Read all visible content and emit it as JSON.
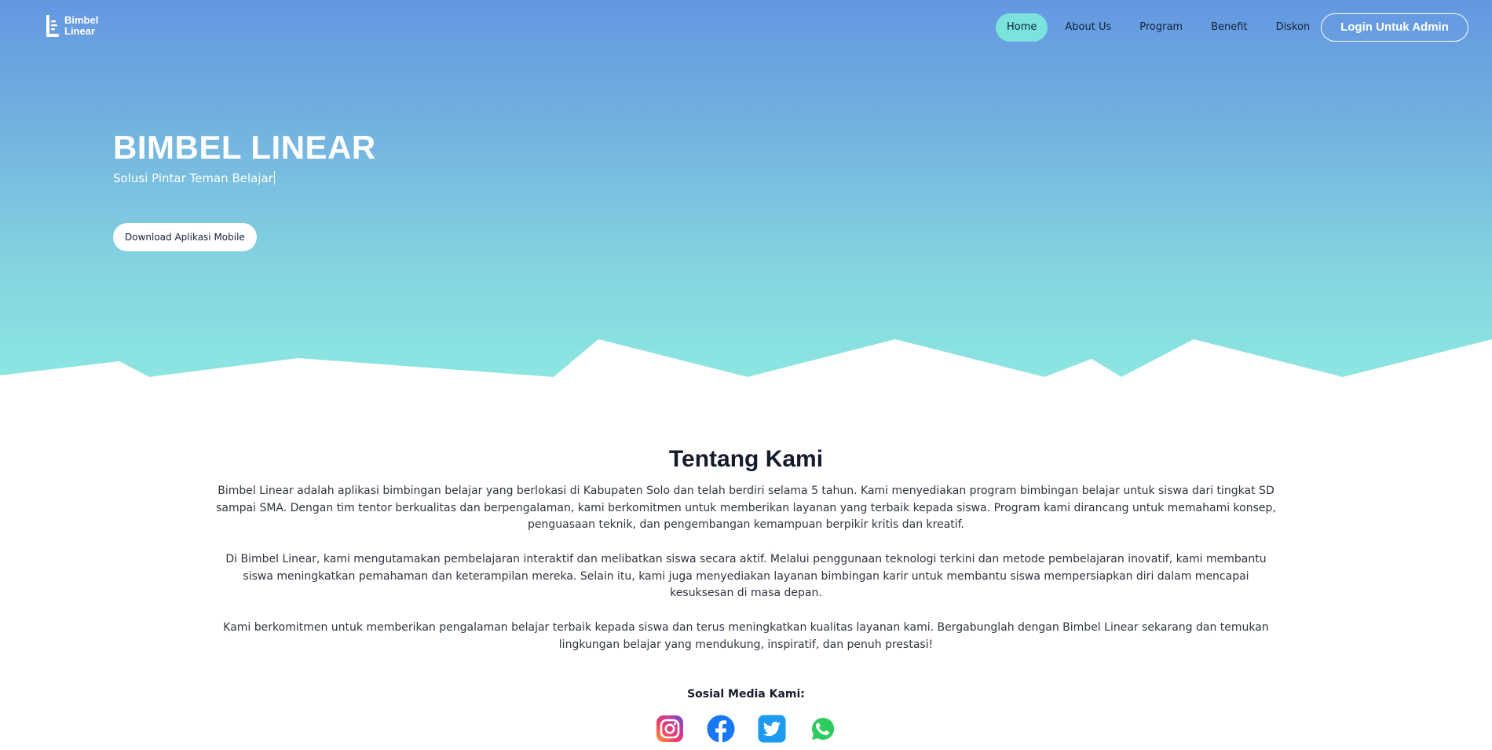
{
  "brand": {
    "line1": "Bimbel",
    "line2": "Linear"
  },
  "nav": {
    "items": [
      {
        "label": "Home",
        "active": true
      },
      {
        "label": "About Us",
        "active": false
      },
      {
        "label": "Program",
        "active": false
      },
      {
        "label": "Benefit",
        "active": false
      },
      {
        "label": "Diskon",
        "active": false
      }
    ],
    "login_label": "Login Untuk Admin"
  },
  "hero": {
    "title": "BIMBEL LINEAR",
    "subtitle": "Solusi Pintar Teman Belajar",
    "download_label": "Download Aplikasi Mobile"
  },
  "about": {
    "title": "Tentang Kami",
    "paragraphs": [
      "Bimbel Linear adalah aplikasi bimbingan belajar yang berlokasi di Kabupaten Solo dan telah berdiri selama 5 tahun. Kami menyediakan program bimbingan belajar untuk siswa dari tingkat SD sampai SMA. Dengan tim tentor berkualitas dan berpengalaman, kami berkomitmen untuk memberikan layanan yang terbaik kepada siswa. Program kami dirancang untuk memahami konsep, penguasaan teknik, dan pengembangan kemampuan berpikir kritis dan kreatif.",
      "Di Bimbel Linear, kami mengutamakan pembelajaran interaktif dan melibatkan siswa secara aktif. Melalui penggunaan teknologi terkini dan metode pembelajaran inovatif, kami membantu siswa meningkatkan pemahaman dan keterampilan mereka. Selain itu, kami juga menyediakan layanan bimbingan karir untuk membantu siswa mempersiapkan diri dalam mencapai kesuksesan di masa depan.",
      "Kami berkomitmen untuk memberikan pengalaman belajar terbaik kepada siswa dan terus meningkatkan kualitas layanan kami. Bergabunglah dengan Bimbel Linear sekarang dan temukan lingkungan belajar yang mendukung, inspiratif, dan penuh prestasi!"
    ]
  },
  "social": {
    "title": "Sosial Media Kami:",
    "icons": [
      "instagram-icon",
      "facebook-icon",
      "twitter-icon",
      "whatsapp-icon"
    ]
  },
  "colors": {
    "hero_top": "#6497e1",
    "hero_bottom": "#8ce6e1",
    "nav_active": "#79e3dc",
    "text_dark": "#141b2a"
  }
}
